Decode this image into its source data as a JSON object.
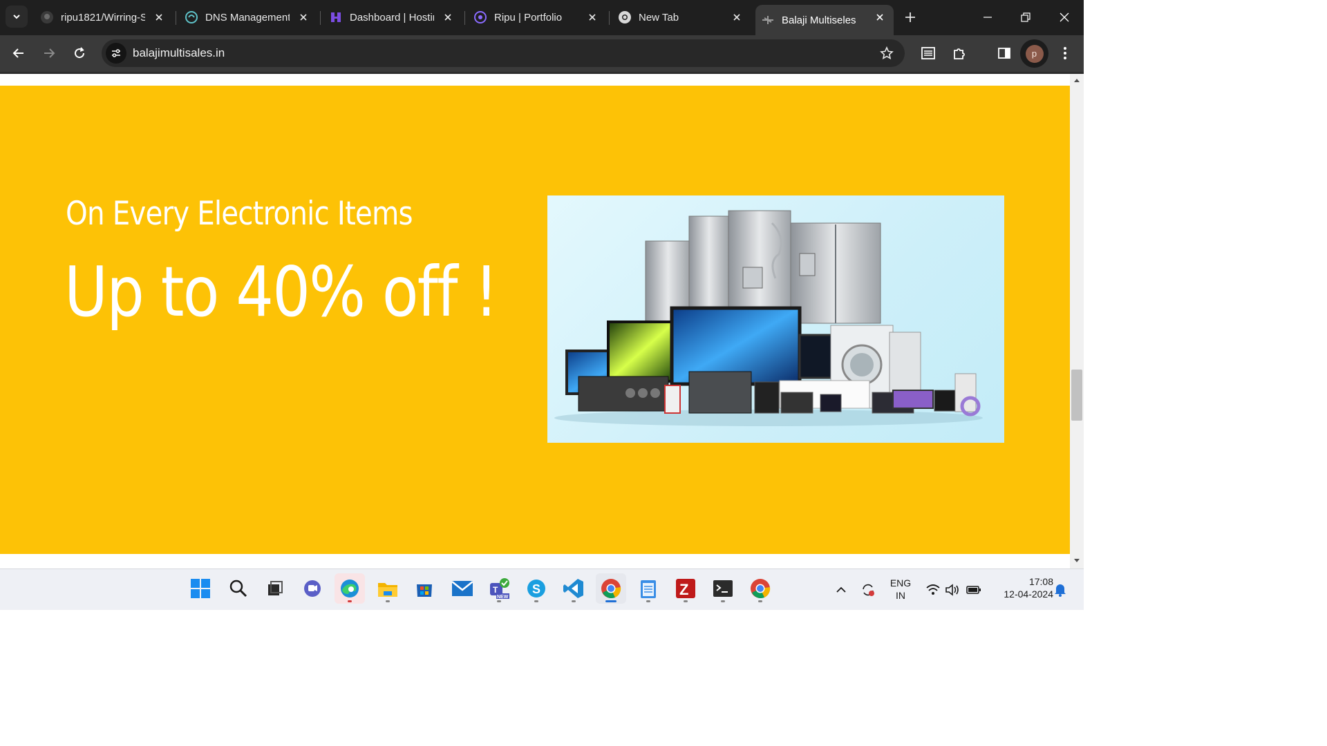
{
  "browser": {
    "tabs": [
      {
        "label": "ripu1821/Wirring-S",
        "icon": "github-icon"
      },
      {
        "label": "DNS Management",
        "icon": "dns-icon"
      },
      {
        "label": "Dashboard | Hostir",
        "icon": "hostinger-icon"
      },
      {
        "label": "Ripu | Portfolio",
        "icon": "portfolio-icon"
      },
      {
        "label": "New Tab",
        "icon": "chrome-icon"
      },
      {
        "label": "Balaji Multiseles",
        "icon": "site-icon",
        "active": true
      }
    ],
    "url": "balajimultisales.in",
    "profile_initial": "p"
  },
  "page": {
    "promo_subtitle": "On Every Electronic Items",
    "promo_title": "Up to 40% off !",
    "banner_color": "#fdc206"
  },
  "taskbar": {
    "apps": [
      "windows-start-icon",
      "search-icon",
      "task-view-icon",
      "teams-chat-icon",
      "edge-icon",
      "file-explorer-icon",
      "microsoft-store-icon",
      "mail-icon",
      "teams-icon",
      "skype-icon",
      "vscode-icon",
      "chrome-icon",
      "notepad-icon",
      "filezilla-icon",
      "terminal-icon",
      "chrome-icon"
    ],
    "language_line1": "ENG",
    "language_line2": "IN",
    "time": "17:08",
    "date": "12-04-2024"
  }
}
